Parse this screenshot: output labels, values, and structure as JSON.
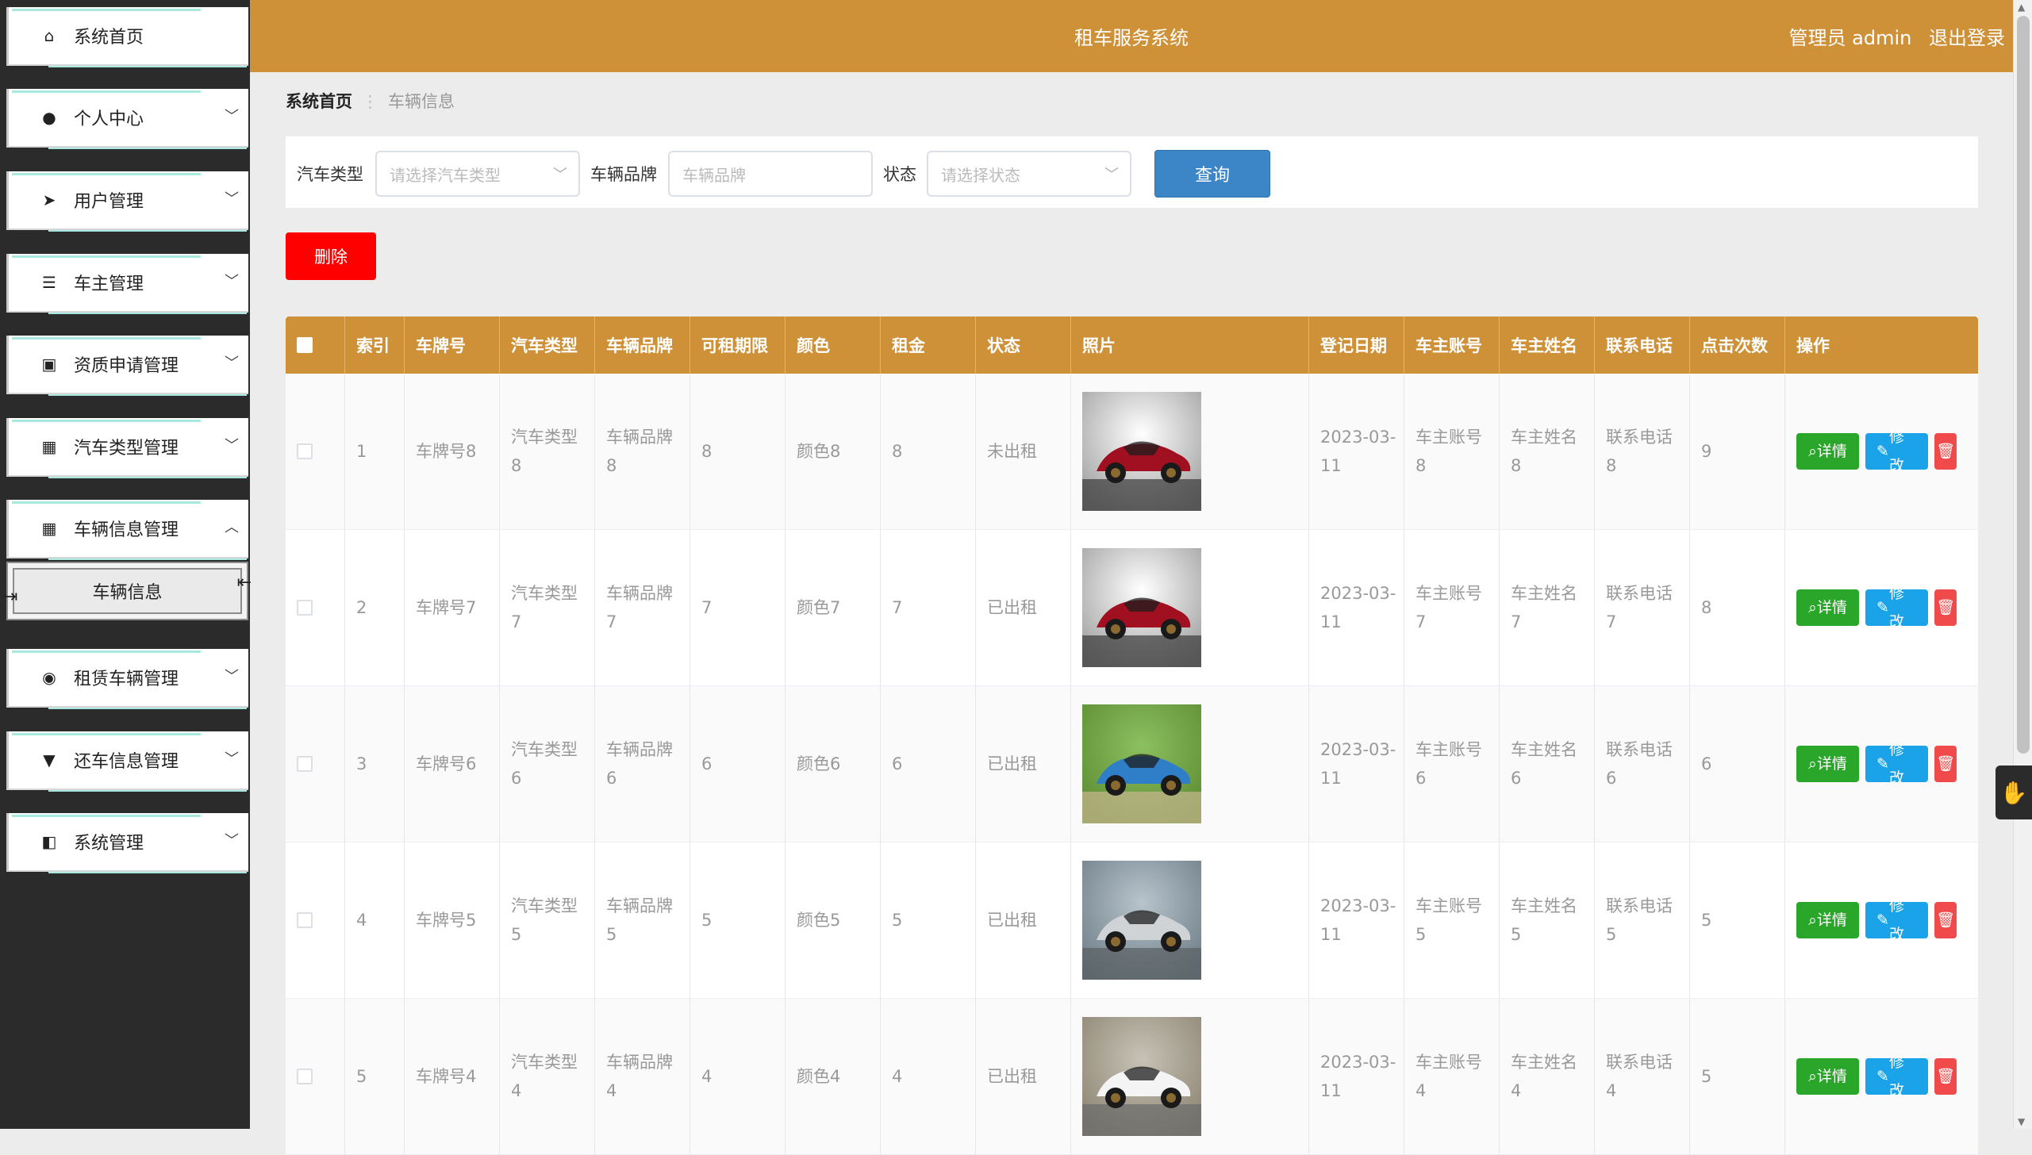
{
  "header": {
    "title": "租车服务系统",
    "user_label": "管理员 admin",
    "logout": "退出登录"
  },
  "sidebar": {
    "items": [
      {
        "label": "系统首页",
        "icon": "home-icon"
      },
      {
        "label": "个人中心",
        "icon": "user-icon"
      },
      {
        "label": "用户管理",
        "icon": "paper-plane-icon"
      },
      {
        "label": "车主管理",
        "icon": "list-icon"
      },
      {
        "label": "资质申请管理",
        "icon": "clipboard-icon"
      },
      {
        "label": "汽车类型管理",
        "icon": "grid-icon"
      },
      {
        "label": "车辆信息管理",
        "icon": "grid-icon"
      },
      {
        "label": "租赁车辆管理",
        "icon": "bulb-icon"
      },
      {
        "label": "还车信息管理",
        "icon": "sign-icon"
      },
      {
        "label": "系统管理",
        "icon": "ticket-icon"
      }
    ],
    "submenu_active": "车辆信息"
  },
  "breadcrumb": {
    "home": "系统首页",
    "current": "车辆信息"
  },
  "search": {
    "car_type_label": "汽车类型",
    "car_type_placeholder": "请选择汽车类型",
    "brand_label": "车辆品牌",
    "brand_placeholder": "车辆品牌",
    "status_label": "状态",
    "status_placeholder": "请选择状态",
    "query_button": "查询"
  },
  "toolbar": {
    "delete_button": "删除"
  },
  "table": {
    "columns": [
      "索引",
      "车牌号",
      "汽车类型",
      "车辆品牌",
      "可租期限",
      "颜色",
      "租金",
      "状态",
      "照片",
      "登记日期",
      "车主账号",
      "车主姓名",
      "联系电话",
      "点击次数",
      "操作"
    ],
    "detail_label": "详情",
    "edit_label": "修改",
    "rows": [
      {
        "index": "1",
        "plate": "车牌号8",
        "type": "汽车类型8",
        "brand": "车辆品牌8",
        "period": "8",
        "color": "颜色8",
        "rent": "8",
        "status": "未出租",
        "date": "2023-03-11",
        "owner_account": "车主账号8",
        "owner_name": "车主姓名8",
        "phone": "联系电话8",
        "clicks": "9",
        "photo": "red-supercar"
      },
      {
        "index": "2",
        "plate": "车牌号7",
        "type": "汽车类型7",
        "brand": "车辆品牌7",
        "period": "7",
        "color": "颜色7",
        "rent": "7",
        "status": "已出租",
        "date": "2023-03-11",
        "owner_account": "车主账号7",
        "owner_name": "车主姓名7",
        "phone": "联系电话7",
        "clicks": "8",
        "photo": "red-supercar"
      },
      {
        "index": "3",
        "plate": "车牌号6",
        "type": "汽车类型6",
        "brand": "车辆品牌6",
        "period": "6",
        "color": "颜色6",
        "rent": "6",
        "status": "已出租",
        "date": "2023-03-11",
        "owner_account": "车主账号6",
        "owner_name": "车主姓名6",
        "phone": "联系电话6",
        "clicks": "6",
        "photo": "blue-rally-car"
      },
      {
        "index": "4",
        "plate": "车牌号5",
        "type": "汽车类型5",
        "brand": "车辆品牌5",
        "period": "5",
        "color": "颜色5",
        "rent": "5",
        "status": "已出租",
        "date": "2023-03-11",
        "owner_account": "车主账号5",
        "owner_name": "车主姓名5",
        "phone": "联系电话5",
        "clicks": "5",
        "photo": "silver-sports-car"
      },
      {
        "index": "5",
        "plate": "车牌号4",
        "type": "汽车类型4",
        "brand": "车辆品牌4",
        "period": "4",
        "color": "颜色4",
        "rent": "4",
        "status": "已出租",
        "date": "2023-03-11",
        "owner_account": "车主账号4",
        "owner_name": "车主姓名4",
        "phone": "联系电话4",
        "clicks": "5",
        "photo": "white-suv"
      }
    ]
  },
  "colors": {
    "accent": "#cf9138",
    "sidebar_bg": "#2b2b2b",
    "query": "#3c86c8",
    "delete": "#ff0000",
    "detail": "#2aa62a",
    "edit": "#1aa3e8"
  }
}
